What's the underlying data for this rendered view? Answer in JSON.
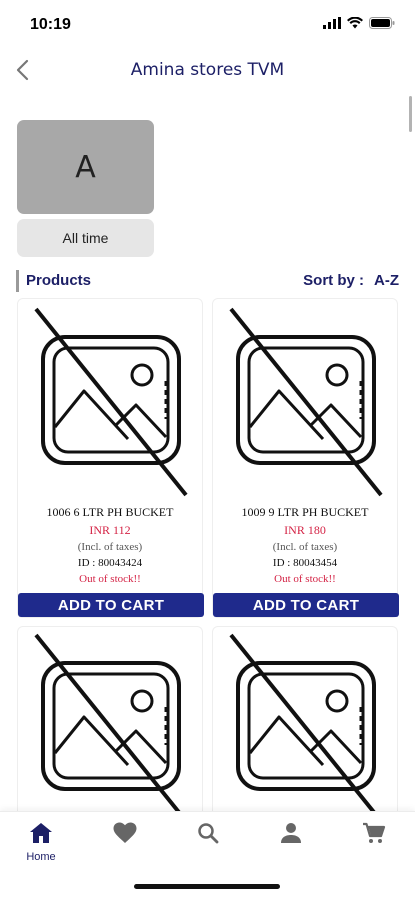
{
  "status_bar": {
    "time": "10:19"
  },
  "nav": {
    "title": "Amina stores TVM",
    "back_icon": "chevron-left-icon"
  },
  "store": {
    "initial": "A",
    "filter_label": "All time"
  },
  "products_section": {
    "title": "Products",
    "sort_label": "Sort by :",
    "sort_value": "A-Z"
  },
  "colors": {
    "brand_navy": "#1c1f66",
    "button_blue": "#1f2a8c",
    "price_red": "#d42345",
    "avatar_gray": "#a8a8a8"
  },
  "products": [
    {
      "name": "1006 6 LTR PH BUCKET",
      "price": "INR 112",
      "tax_note": "(Incl. of taxes)",
      "id": "ID : 80043424",
      "stock": "Out of stock!!",
      "button": "ADD TO CART"
    },
    {
      "name": "1009 9 LTR PH BUCKET",
      "price": "INR 180",
      "tax_note": "(Incl. of taxes)",
      "id": "ID : 80043454",
      "stock": "Out of stock!!",
      "button": "ADD TO CART"
    },
    {
      "image_icon": "image-placeholder-icon"
    },
    {
      "image_icon": "image-placeholder-icon"
    }
  ],
  "tab_bar": {
    "items": [
      {
        "icon": "home-icon",
        "label": "Home"
      },
      {
        "icon": "heart-icon",
        "label": ""
      },
      {
        "icon": "search-icon",
        "label": ""
      },
      {
        "icon": "person-icon",
        "label": ""
      },
      {
        "icon": "cart-icon",
        "label": ""
      }
    ]
  }
}
